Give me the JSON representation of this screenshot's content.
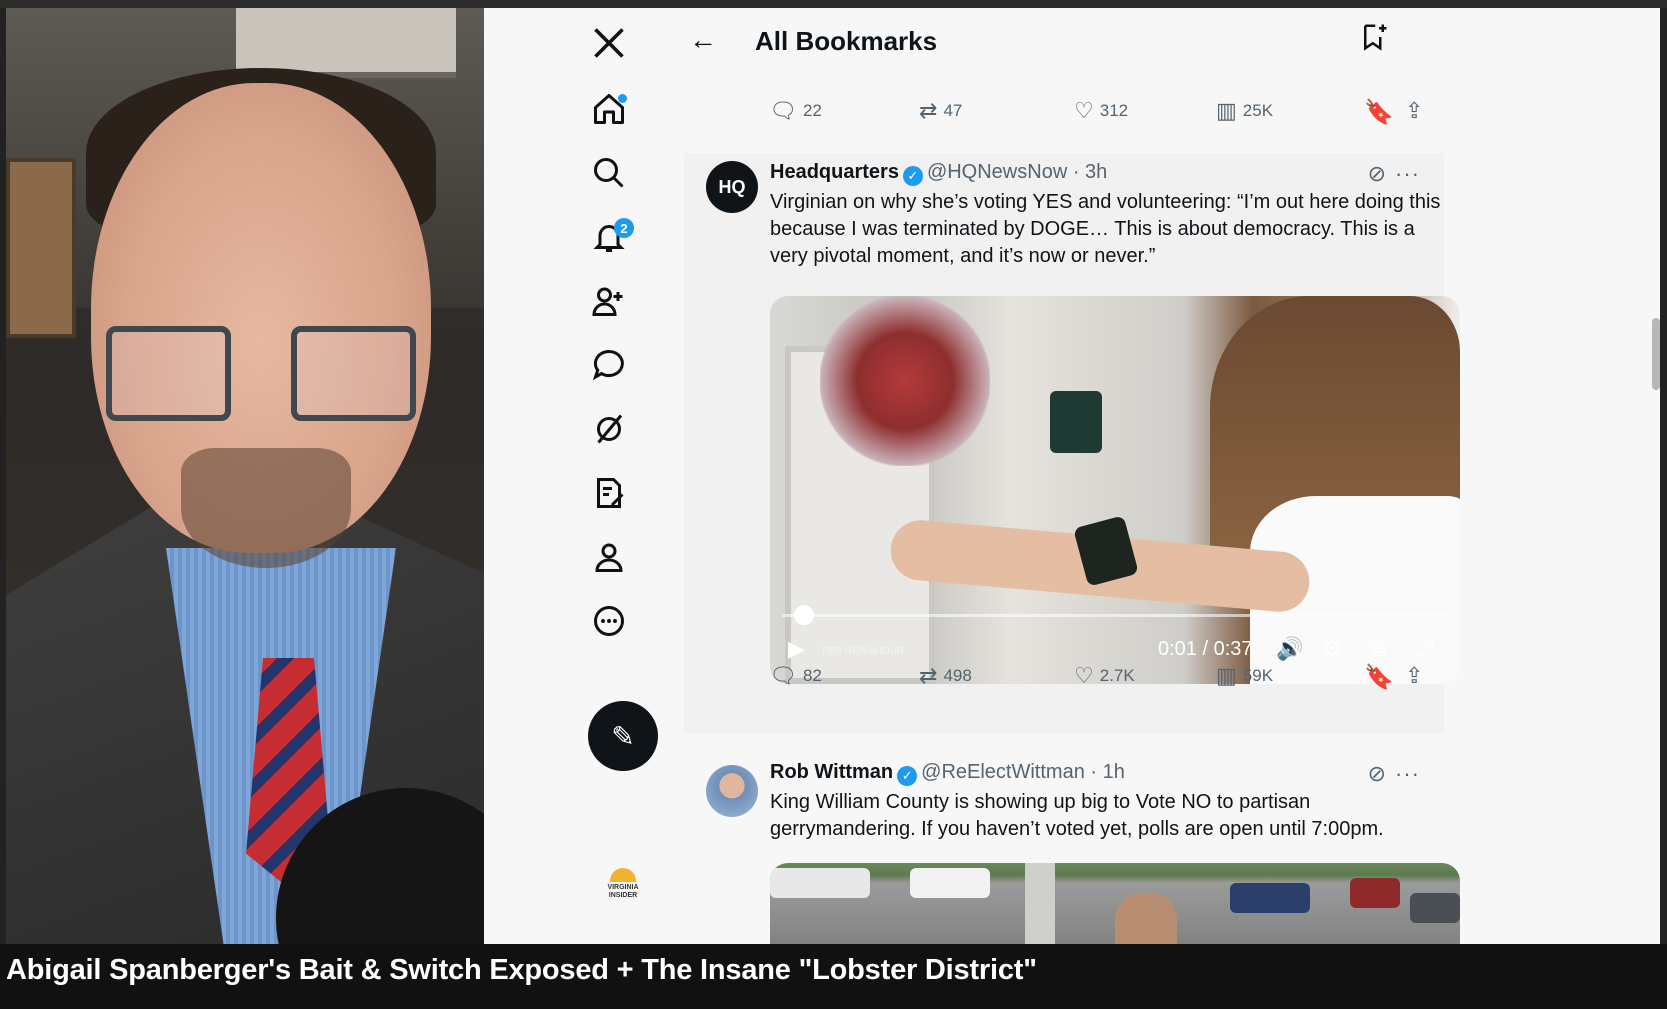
{
  "caption": "Abigail Spanberger's Bait & Switch Exposed + The Insane \"Lobster District\"",
  "header": {
    "title": "All Bookmarks",
    "back_icon": "arrow-left-icon",
    "add_icon": "add-bookmark-folder-icon"
  },
  "nav": {
    "items": [
      {
        "name": "x-logo-icon"
      },
      {
        "name": "home-icon",
        "dot": true
      },
      {
        "name": "search-icon"
      },
      {
        "name": "notifications-icon",
        "badge": "2"
      },
      {
        "name": "follow-icon"
      },
      {
        "name": "messages-icon"
      },
      {
        "name": "grok-icon"
      },
      {
        "name": "lists-icon"
      },
      {
        "name": "profile-icon"
      },
      {
        "name": "more-icon"
      }
    ],
    "compose_icon": "compose-post-icon",
    "notif_badge": "2",
    "brand_logo": "VIRGINIA INSIDER"
  },
  "prev_tweet_actions": {
    "replies": "22",
    "reposts": "47",
    "likes": "312",
    "views": "25K"
  },
  "tweets": [
    {
      "name": "Headquarters",
      "avatar_text": "HQ",
      "handle": "@HQNewsNow",
      "time": "· 3h",
      "text": "Virginian on why she’s voting YES and volunteering: “I’m out here doing this because I was terminated by DOGE… This is about democracy. This is a very pivotal moment, and it’s now or never.”",
      "video": {
        "time": "0:01 / 0:37",
        "watermark": "PBS NEWSHOUR",
        "progress": 0.03
      },
      "actions": {
        "replies": "82",
        "reposts": "498",
        "likes": "2.7K",
        "views": "59K"
      }
    },
    {
      "name": "Rob Wittman",
      "handle": "@ReElectWittman",
      "time": "· 1h",
      "text": "King William County is showing up big to Vote NO to partisan gerrymandering. If you haven’t voted yet, polls are open until 7:00pm."
    }
  ],
  "colors": {
    "accent": "#1d9bf0",
    "text": "#0f1419",
    "muted": "#536471"
  }
}
